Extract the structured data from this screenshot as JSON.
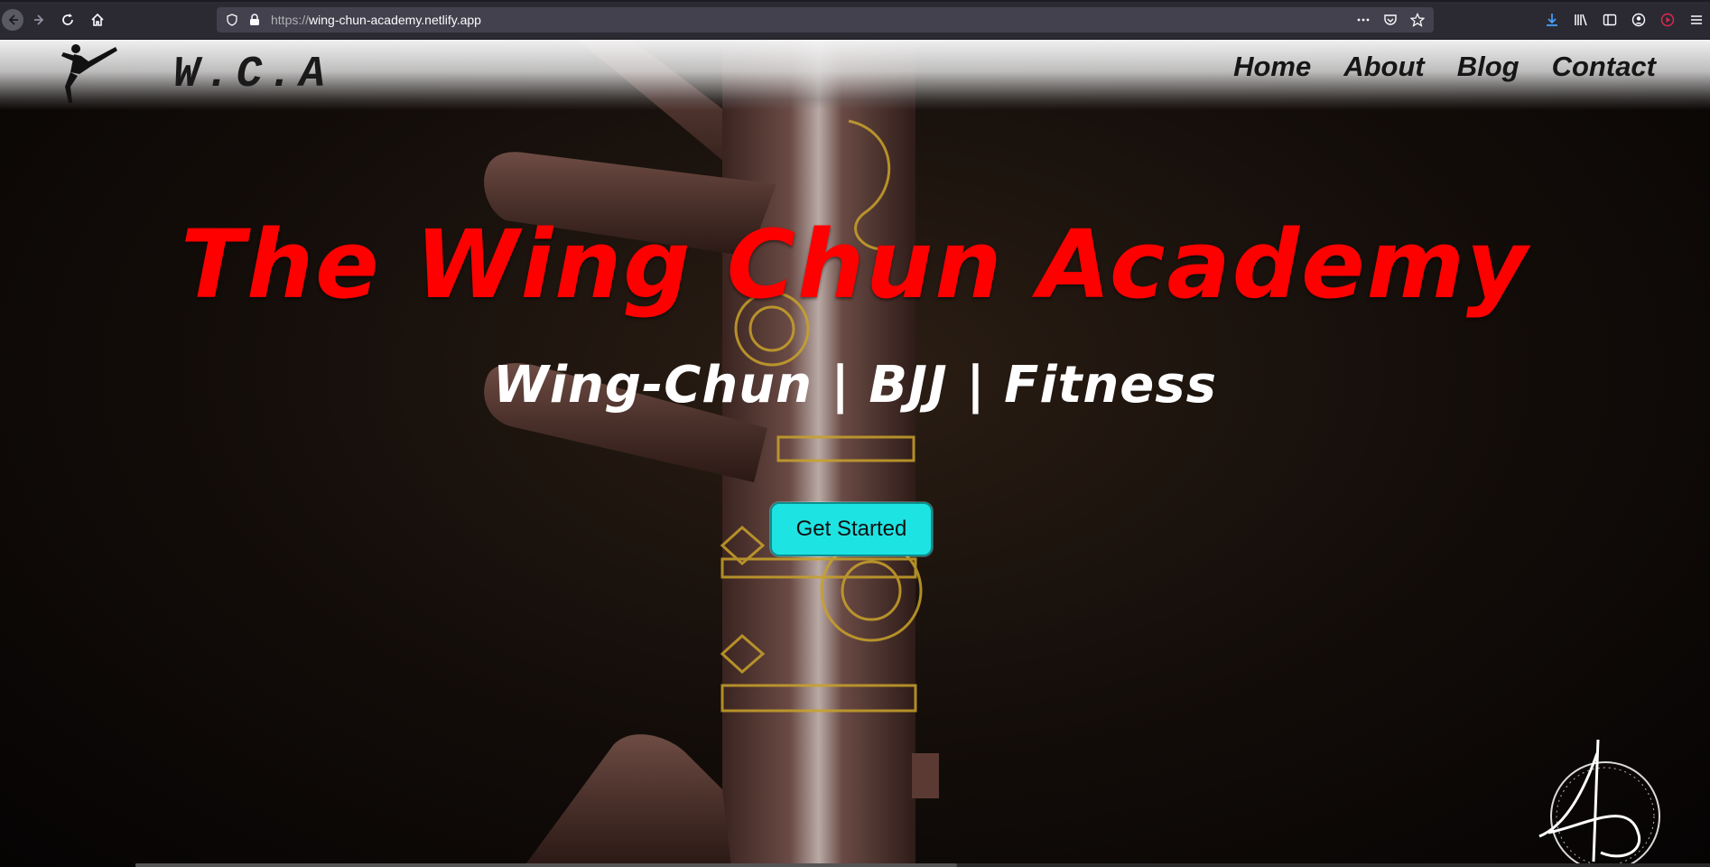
{
  "browser": {
    "url_protocol": "https://",
    "url_host": "wing-chun-academy.netlify.app",
    "accent_download": "#45a1ff",
    "accent_record": "#e22850"
  },
  "header": {
    "brand": "W.C.A",
    "nav": [
      "Home",
      "About",
      "Blog",
      "Contact"
    ]
  },
  "hero": {
    "title": "The Wing Chun Academy",
    "subtitle": "Wing-Chun | BJJ | Fitness",
    "cta_label": "Get Started",
    "title_color": "#ff0000",
    "cta_color": "#1ee3e3"
  }
}
